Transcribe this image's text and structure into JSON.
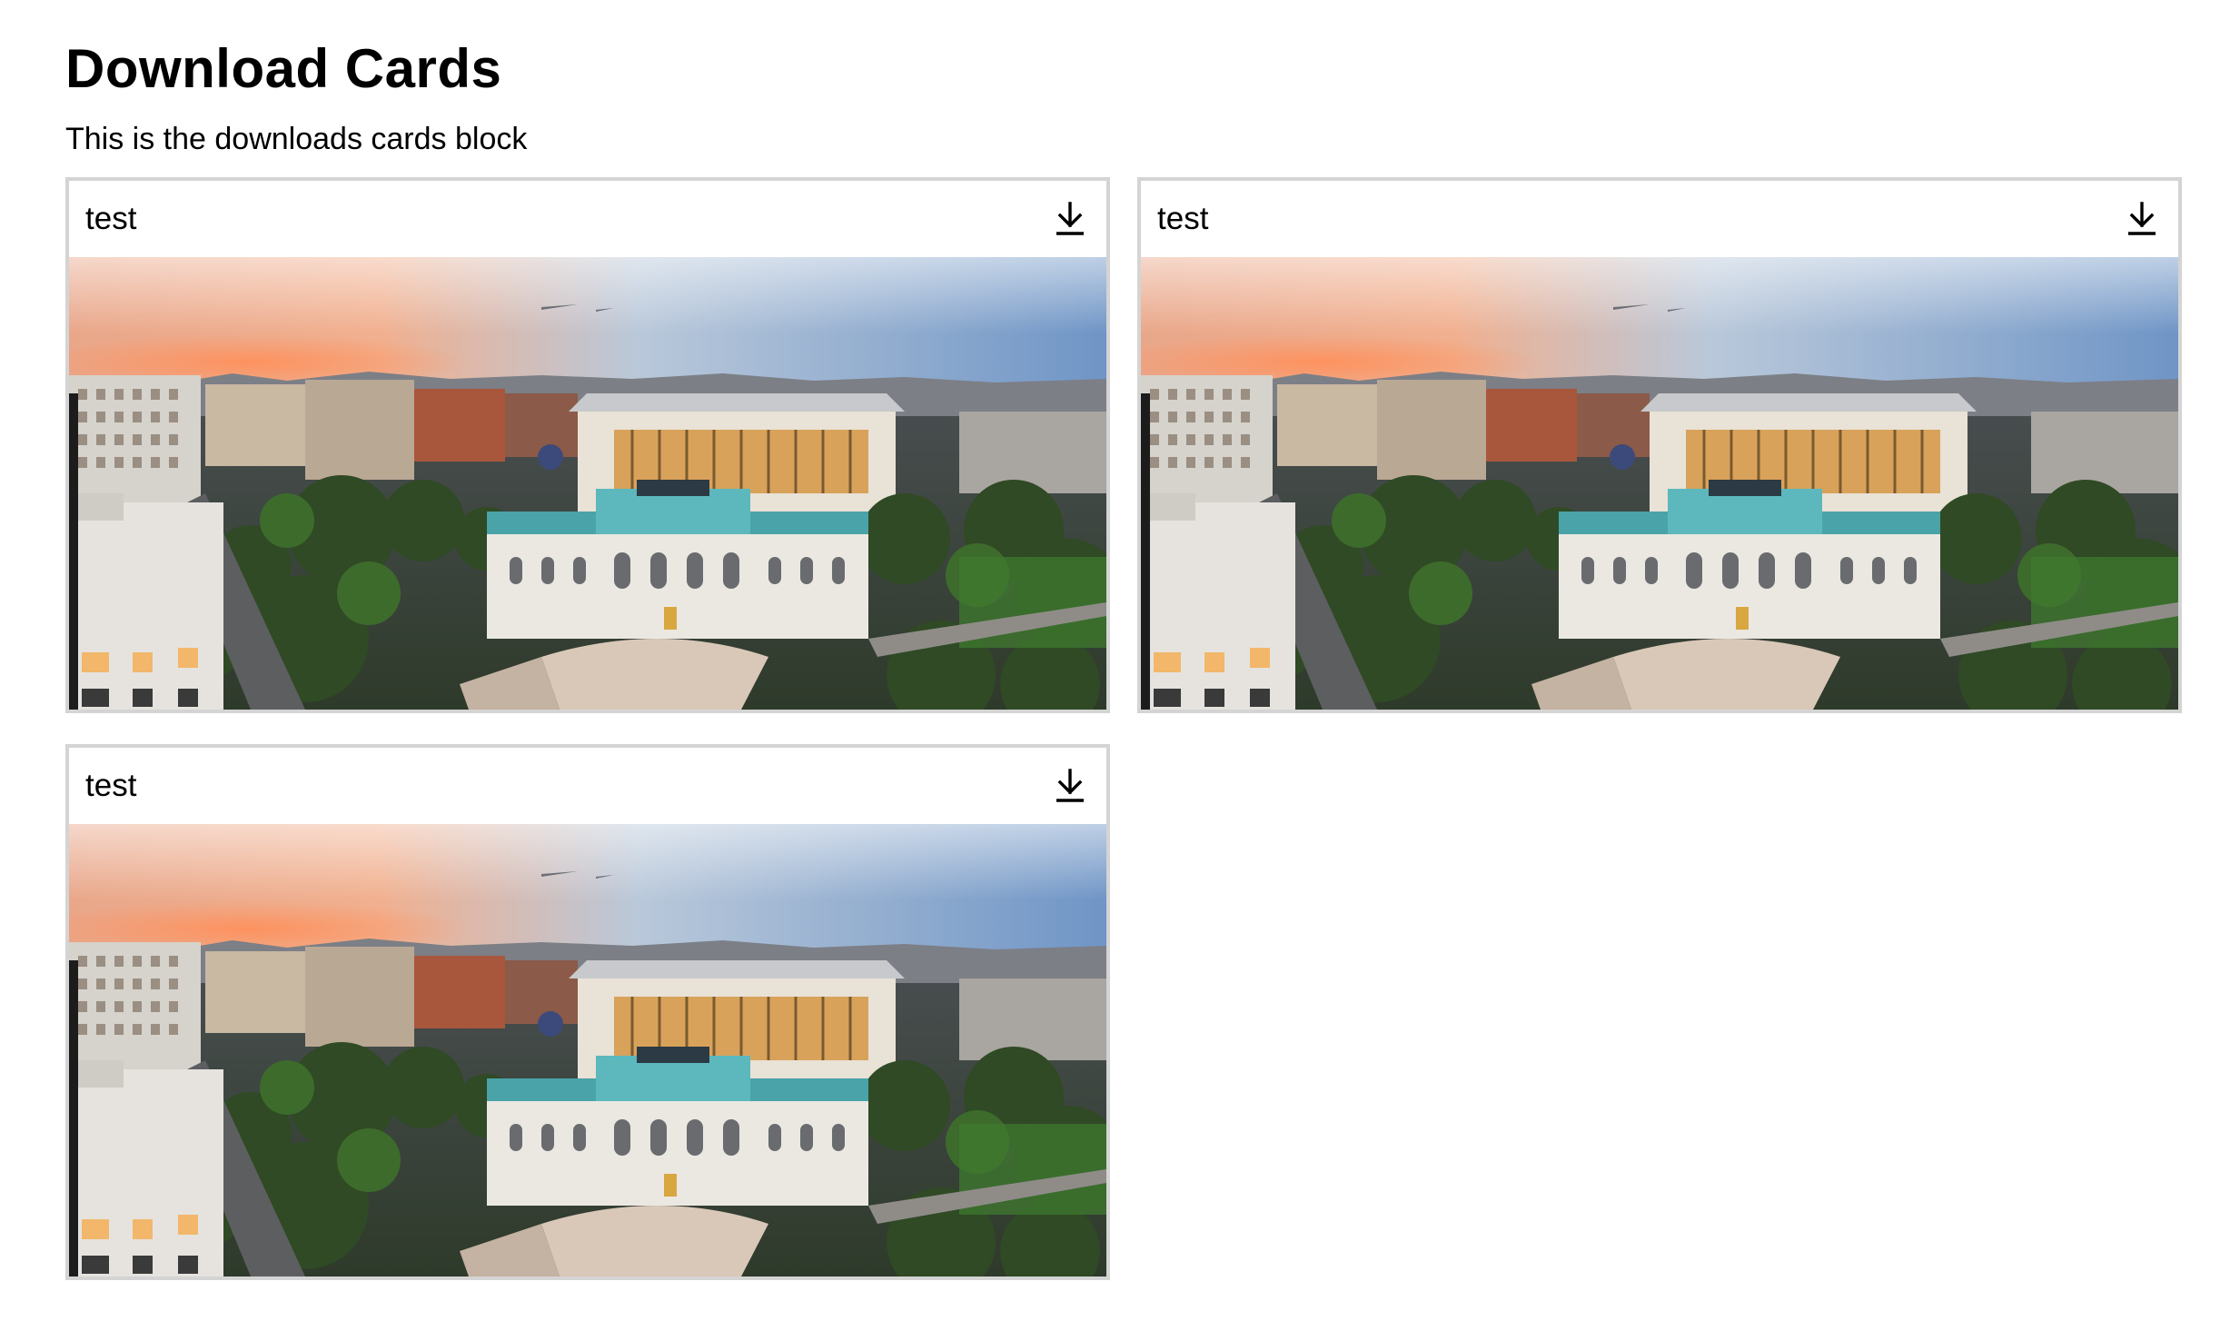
{
  "page": {
    "title": "Download Cards",
    "description": "This is the downloads cards block"
  },
  "cards": [
    {
      "title": "test",
      "download_icon": "download-icon",
      "image_alt": "aerial-city-library-photo"
    },
    {
      "title": "test",
      "download_icon": "download-icon",
      "image_alt": "aerial-city-library-photo"
    },
    {
      "title": "test",
      "download_icon": "download-icon",
      "image_alt": "aerial-city-library-photo"
    }
  ],
  "colors": {
    "card_border": "#d4d4d4",
    "text": "#000000",
    "background": "#ffffff"
  }
}
